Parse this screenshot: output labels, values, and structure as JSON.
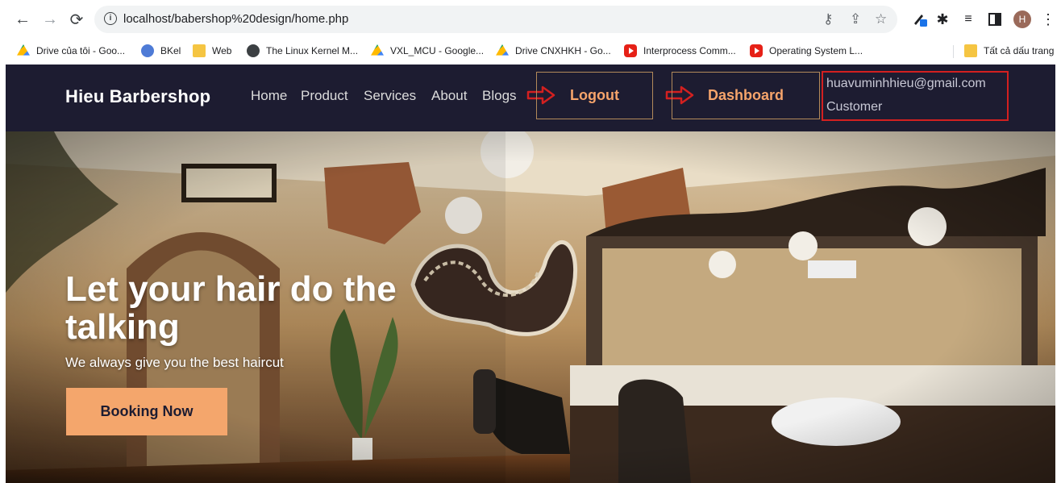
{
  "browser": {
    "url": "localhost/babershop%20design/home.php",
    "avatar_letter": "H",
    "bookmarks": [
      {
        "label": "Drive của tôi - Goo...",
        "icon": "drive-icon"
      },
      {
        "label": "BKel",
        "icon": "people-icon"
      },
      {
        "label": "Web",
        "icon": "folder-icon"
      },
      {
        "label": "The Linux Kernel M...",
        "icon": "globe-icon"
      },
      {
        "label": "VXL_MCU - Google...",
        "icon": "drive-icon"
      },
      {
        "label": "Drive CNXHKH - Go...",
        "icon": "drive-icon"
      },
      {
        "label": "Interprocess Comm...",
        "icon": "youtube-icon"
      },
      {
        "label": "Operating System L...",
        "icon": "youtube-icon"
      }
    ],
    "all_bookmarks_label": "Tất cả dấu trang"
  },
  "site": {
    "logo": "Hieu Barbershop",
    "nav": [
      "Home",
      "Product",
      "Services",
      "About",
      "Blogs"
    ],
    "logout_label": "Logout",
    "dashboard_label": "Dashboard",
    "user_email": "huavuminhhieu@gmail.com",
    "user_role": "Customer",
    "accent_color": "#f4a66c",
    "header_color": "#1d1c31",
    "annotation_color": "#d32020"
  },
  "hero": {
    "title": "Let your hair do the talking",
    "subtitle": "We always give you the best haircut",
    "cta": "Booking Now"
  }
}
